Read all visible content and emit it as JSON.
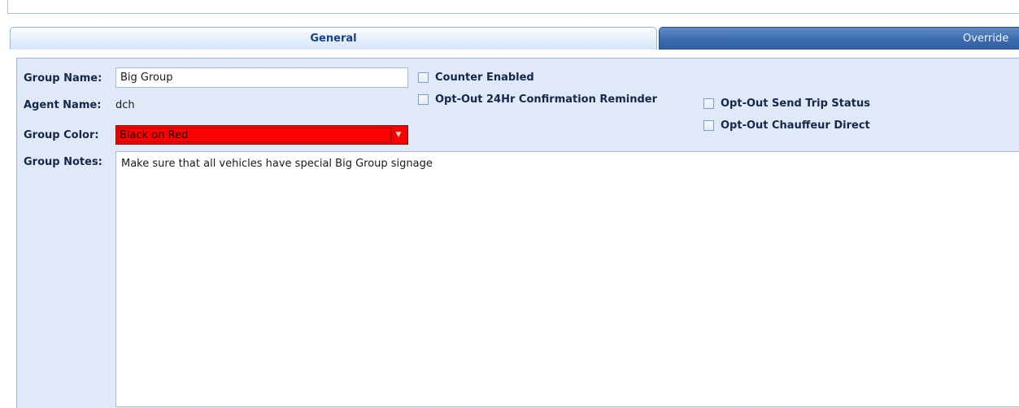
{
  "tabs": [
    {
      "label": "General",
      "active": true
    },
    {
      "label": "Override",
      "active": false
    }
  ],
  "form": {
    "group_name": {
      "label": "Group Name:",
      "value": "Big Group"
    },
    "agent_name": {
      "label": "Agent Name:",
      "value": "dch"
    },
    "group_color": {
      "label": "Group Color:",
      "value": "Black on Red",
      "swatch": "#ff0000",
      "icon": "dropdown-arrow-icon"
    },
    "group_notes": {
      "label": "Group Notes:",
      "value": "Make sure that all vehicles have special Big Group signage"
    }
  },
  "options": [
    {
      "label": "Counter Enabled",
      "checked": false
    },
    {
      "label": "Opt-Out 24Hr Confirmation Reminder",
      "checked": false
    },
    {
      "label": "Opt-Out Send Trip Status",
      "checked": false
    },
    {
      "label": "Opt-Out Chauffeur Direct",
      "checked": false
    }
  ],
  "colors": {
    "accent": "#15428b",
    "panel_bg": "#dfe9f7",
    "tab_inactive": "#3b6bae"
  }
}
